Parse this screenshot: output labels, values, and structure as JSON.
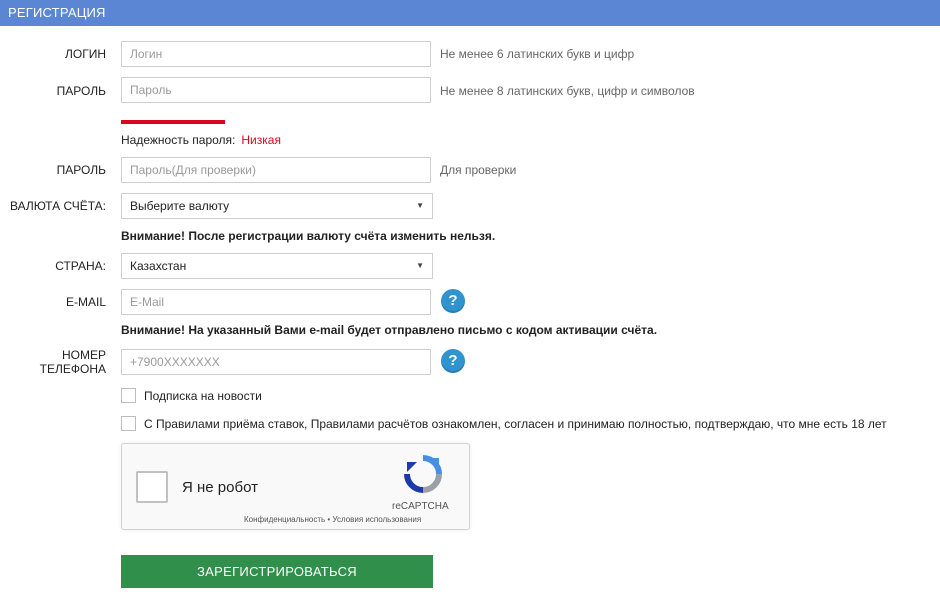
{
  "header": {
    "title": "РЕГИСТРАЦИЯ"
  },
  "form": {
    "login": {
      "label": "ЛОГИН",
      "placeholder": "Логин",
      "hint": "Не менее 6 латинских букв и цифр"
    },
    "password": {
      "label": "ПАРОЛЬ",
      "placeholder": "Пароль",
      "hint": "Не менее 8 латинских букв, цифр и символов"
    },
    "strength": {
      "label": "Надежность пароля:",
      "value": "Низкая",
      "color": "#d9061b"
    },
    "password_confirm": {
      "label": "ПАРОЛЬ",
      "placeholder": "Пароль(Для проверки)",
      "hint": "Для проверки"
    },
    "currency": {
      "label": "ВАЛЮТА СЧЁТА:",
      "selected": "Выберите валюту",
      "warning": "Внимание! После регистрации валюту счёта изменить нельзя."
    },
    "country": {
      "label": "СТРАНА:",
      "selected": "Казахстан"
    },
    "email": {
      "label": "E-MAIL",
      "placeholder": "E-Mail",
      "help": "?",
      "warning": "Внимание! На указанный Вами e-mail будет отправлено письмо с кодом активации счёта."
    },
    "phone": {
      "label_line1": "НОМЕР",
      "label_line2": "ТЕЛЕФОНА",
      "placeholder": "+7900XXXXXXX",
      "help": "?"
    },
    "newsletter": {
      "label": "Подписка на новости",
      "checked": false
    },
    "rules": {
      "label": "С Правилами приёма ставок, Правилами расчётов ознакомлен, согласен и принимаю полностью, подтверждаю, что мне есть 18 лет",
      "checked": false
    },
    "captcha": {
      "text": "Я не робот",
      "brand": "reCAPTCHA",
      "links": "Конфиденциальность • Условия использования"
    },
    "submit": {
      "label": "ЗАРЕГИСТРИРОВАТЬСЯ"
    }
  },
  "colors": {
    "header": "#5b86d4",
    "submit": "#2f8f4b",
    "help": "#2e93cf",
    "danger": "#d9061b"
  }
}
